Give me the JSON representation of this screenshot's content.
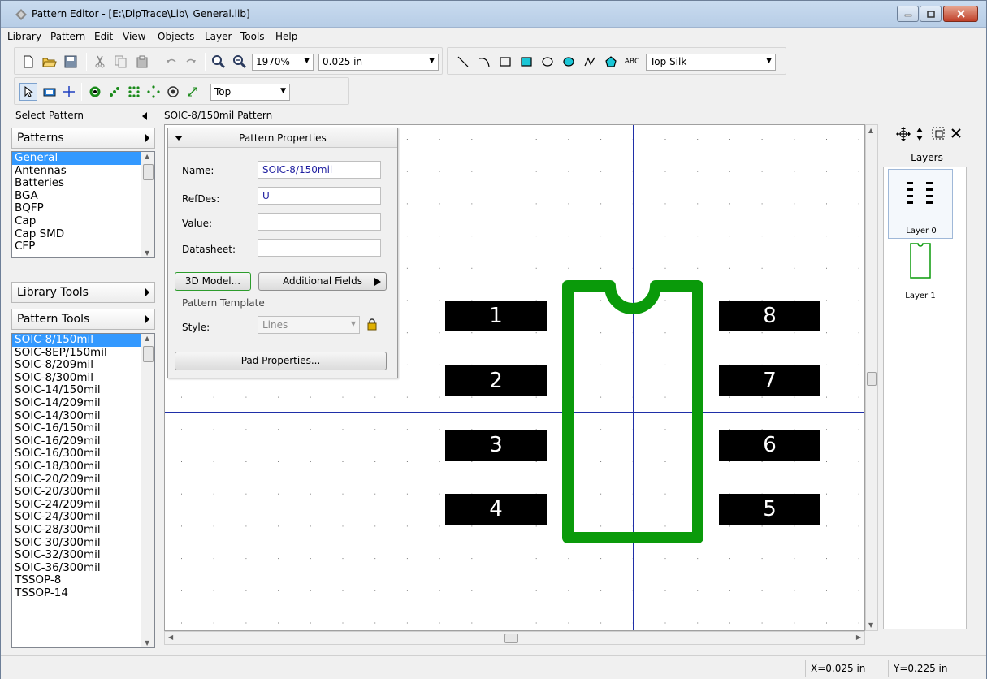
{
  "window": {
    "title": "Pattern Editor - [E:\\DipTrace\\Lib\\_General.lib]"
  },
  "menu": [
    "Library",
    "Pattern",
    "Edit",
    "View",
    "Objects",
    "Layer",
    "Tools",
    "Help"
  ],
  "toolbar": {
    "zoom": "1970%",
    "grid": "0.025 in",
    "text_icon_label": "ABC",
    "layer_select": "Top Silk",
    "side_select": "Top"
  },
  "left_panel": {
    "header": "Select Pattern",
    "patterns_label": "Patterns",
    "library_tools_label": "Library Tools",
    "pattern_tools_label": "Pattern Tools",
    "libraries": [
      "General",
      "Antennas",
      "Batteries",
      "BGA",
      "BQFP",
      "Cap",
      "Cap SMD",
      "CFP"
    ],
    "selected_library": "General",
    "patterns": [
      "SOIC-8/150mil",
      "SOIC-8EP/150mil",
      "SOIC-8/209mil",
      "SOIC-8/300mil",
      "SOIC-14/150mil",
      "SOIC-14/209mil",
      "SOIC-14/300mil",
      "SOIC-16/150mil",
      "SOIC-16/209mil",
      "SOIC-16/300mil",
      "SOIC-18/300mil",
      "SOIC-20/209mil",
      "SOIC-20/300mil",
      "SOIC-24/209mil",
      "SOIC-24/300mil",
      "SOIC-28/300mil",
      "SOIC-30/300mil",
      "SOIC-32/300mil",
      "SOIC-36/300mil",
      "TSSOP-8",
      "TSSOP-14"
    ],
    "selected_pattern": "SOIC-8/150mil"
  },
  "canvas": {
    "title": "SOIC-8/150mil Pattern",
    "pads_left": [
      "1",
      "2",
      "3",
      "4"
    ],
    "pads_right": [
      "8",
      "7",
      "6",
      "5"
    ]
  },
  "properties": {
    "header": "Pattern Properties",
    "name_label": "Name:",
    "name_value": "SOIC-8/150mil",
    "refdes_label": "RefDes:",
    "refdes_value": "U",
    "value_label": "Value:",
    "value_value": "",
    "datasheet_label": "Datasheet:",
    "datasheet_value": "",
    "model_button": "3D Model...",
    "fields_button": "Additional Fields",
    "template_label": "Pattern Template",
    "style_label": "Style:",
    "style_value": "Lines",
    "pad_button": "Pad Properties..."
  },
  "layers": {
    "header": "Layers",
    "items": [
      "Layer 0",
      "Layer 1"
    ]
  },
  "status": {
    "x": "X=0.025 in",
    "y": "Y=0.225 in"
  },
  "colors": {
    "silk_outline": "#0a9a0a",
    "crosshair": "#1f2fa8",
    "selection": "#3399ff"
  }
}
